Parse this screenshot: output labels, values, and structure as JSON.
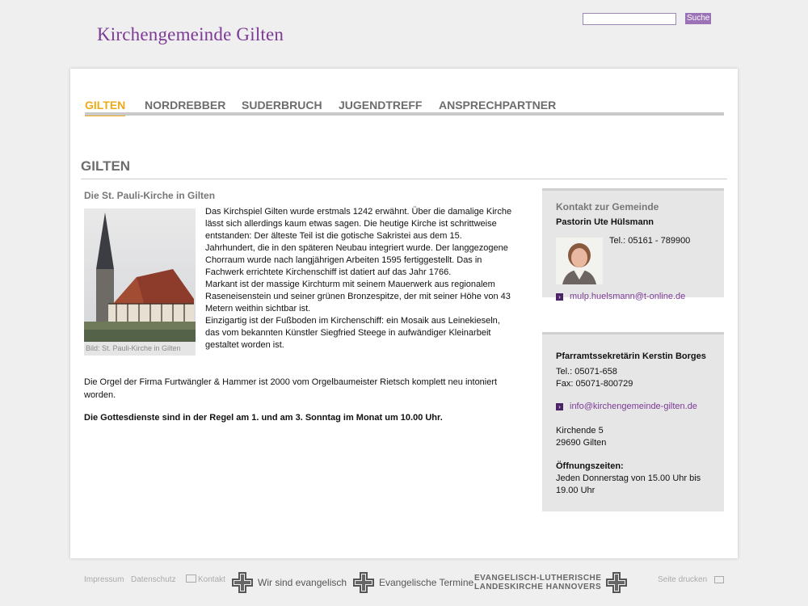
{
  "header": {
    "site_title": "Kirchengemeinde Gilten",
    "search_button": "Suche",
    "search_value": ""
  },
  "nav": {
    "items": [
      {
        "label": "GILTEN",
        "active": true
      },
      {
        "label": "NORDREBBER",
        "active": false
      },
      {
        "label": "SUDERBRUCH",
        "active": false
      },
      {
        "label": "JUGENDTREFF",
        "active": false
      },
      {
        "label": "ANSPRECHPARTNER",
        "active": false
      }
    ]
  },
  "page": {
    "heading": "GILTEN",
    "article_title": "Die St. Pauli-Kirche in Gilten",
    "photo_caption": "Bild: St. Pauli-Kirche in Gilten",
    "paragraphs": [
      "Das Kirchspiel Gilten wurde erstmals 1242 erwähnt. Über die damalige Kirche lässt sich allerdings kaum etwas sagen. Die heutige Kirche ist schrittweise entstanden: Der älteste Teil ist die gotische Sakristei aus dem 15. Jahrhundert, die in den späteren Neubau integriert wurde. Der langgezogene Chorraum wurde nach langjährigen Arbeiten 1595 fertiggestellt. Das in Fachwerk errichtete Kirchenschiff ist datiert auf das Jahr 1766.",
      "Markant ist der massige Kirchturm mit seinem Mauerwerk aus regionalem Raseneisenstein und seiner grünen Bronzespitze, der mit seiner Höhe von 43 Metern weithin sichtbar ist.",
      "Einzigartig ist der Fußboden im Kirchenschiff: ein Mosaik aus Leinekieseln, das vom bekannten Künstler Siegfried Steege in aufwändiger Kleinarbeit gestaltet worden ist."
    ],
    "organ_text": "Die Orgel der Firma Furtwängler & Hammer ist 2000 vom Orgelbaumeister Rietsch komplett neu intoniert worden.",
    "services_text": "Die Gottesdienste sind in der Regel am 1. und am 3. Sonntag im Monat um 10.00 Uhr."
  },
  "sidebar": {
    "contact": {
      "title": "Kontakt zur Gemeinde",
      "name": "Pastorin Ute Hülsmann",
      "tel": "Tel.: 05161 - 789900",
      "email": "mulp.huelsmann@t-online.de"
    },
    "office": {
      "name": "Pfarramtssekretärin Kerstin Borges",
      "tel": "Tel.: 05071-658",
      "fax": "Fax: 05071-800729",
      "email": "info@kirchengemeinde-gilten.de",
      "street": "Kirchende 5",
      "city": "29690 Gilten",
      "hours_label": "Öffnungszeiten:",
      "hours": "Jeden Donnerstag von 15.00 Uhr bis 19.00 Uhr"
    }
  },
  "footer": {
    "impressum": "Impressum",
    "datenschutz": "Datenschutz",
    "kontakt": "Kontakt",
    "logo1": "Wir sind evangelisch",
    "logo2": "Evangelische Termine",
    "logo3_line1": "EVANGELISCH-LUTHERISCHE",
    "logo3_line2": "LANDESKIRCHE HANNOVERS",
    "print": "Seite drucken"
  },
  "colors": {
    "brand_purple": "#7c3a96",
    "nav_active": "#efaa1a",
    "nav_text": "#6d6d6d"
  }
}
